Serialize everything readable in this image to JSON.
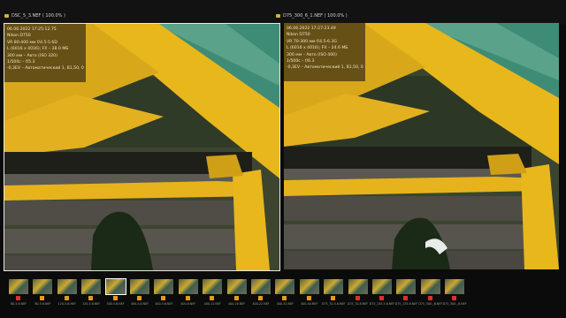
{
  "left": {
    "filename": "DSC_5_3.NEF ( 100.0% )",
    "exif": [
      "06.06.2022 17:25:12.75",
      "Nikon D750",
      "VR 80-400 мм f/4.5-5.6D",
      "L (6016 x 4016); FX – 28.0 МБ",
      "300 мм – Авто (ISO 320)",
      "1/500с – f/5.3",
      "-0,3EV – Автоматический 1, B1,50, 0"
    ]
  },
  "right": {
    "filename": "D75_300_6_1.NEF ( 100.0% )",
    "exif": [
      "06.06.2022 17:27:23.49",
      "Nikon D750",
      "VR 70-300 мм f/4.5-6.3G",
      "L (6016 x 4016); FX – 24.6 МБ",
      "300 мм – Авто (ISO 400)",
      "1/500с – f/6.3",
      "-0,3EV – Автоматический 1, B1,50, 0"
    ]
  },
  "filmstrip": {
    "thumbs": [
      {
        "label": "80-5.6.NEF",
        "mark": "red",
        "selected": false
      },
      {
        "label": "80-5.6.NEF",
        "mark": "orange",
        "selected": false
      },
      {
        "label": "120-5.6.NEF",
        "mark": "orange",
        "selected": false
      },
      {
        "label": "120-5.6.NEF",
        "mark": "orange",
        "selected": false
      },
      {
        "label": "300-5.6.NEF",
        "mark": "orange",
        "selected": true
      },
      {
        "label": "400-5.6.NEF",
        "mark": "orange",
        "selected": false
      },
      {
        "label": "400-5.6.NEF",
        "mark": "orange",
        "selected": false
      },
      {
        "label": "400-8.NEF",
        "mark": "orange",
        "selected": false
      },
      {
        "label": "400-11.NEF",
        "mark": "orange",
        "selected": false
      },
      {
        "label": "400-16.NEF",
        "mark": "orange",
        "selected": false
      },
      {
        "label": "400-22.NEF",
        "mark": "orange",
        "selected": false
      },
      {
        "label": "400-32.NEF",
        "mark": "orange",
        "selected": false
      },
      {
        "label": "400-40.NEF",
        "mark": "orange",
        "selected": false
      },
      {
        "label": "D75_70-5.6.NEF",
        "mark": "orange",
        "selected": false
      },
      {
        "label": "D75_70-8.NEF",
        "mark": "red",
        "selected": false
      },
      {
        "label": "D75_135-5.6.NEF",
        "mark": "red",
        "selected": false
      },
      {
        "label": "D75_135-8.NEF",
        "mark": "red",
        "selected": false
      },
      {
        "label": "D75_300-_6.NEF",
        "mark": "red",
        "selected": false
      },
      {
        "label": "D75_300-_8.NEF",
        "mark": "red",
        "selected": false
      }
    ]
  },
  "colors": {
    "mark_orange": "#e39a1e",
    "mark_red": "#d2352b",
    "yellow": "#e8b71c",
    "green_roof": "#3f8c76"
  }
}
